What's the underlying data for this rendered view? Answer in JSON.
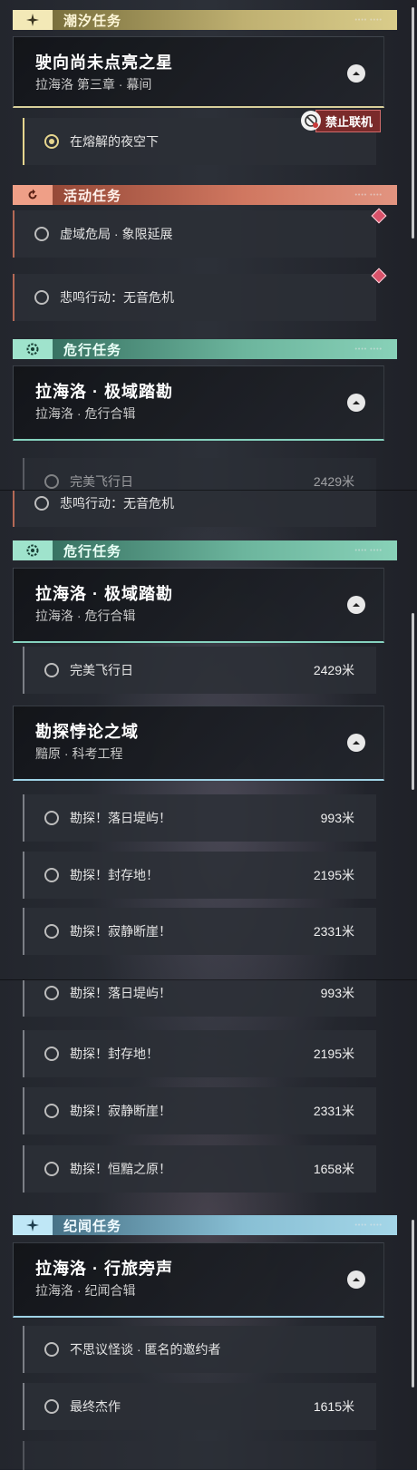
{
  "segment_a": {
    "cat_tide": "潮汐任务",
    "tide_mission": {
      "title": "驶向尚未点亮之星",
      "subtitle": "拉海洛 第三章 · 幕间"
    },
    "tide_task": "在熔解的夜空下",
    "no_coop_label": "禁止联机",
    "cat_event": "活动任务",
    "event_tasks": [
      "虚域危局 · 象限延展",
      "悲鸣行动：无音危机"
    ],
    "cat_danger": "危行任务",
    "danger_mission": {
      "title": "拉海洛 · 极域踏勘",
      "subtitle": "拉海洛 · 危行合辑"
    },
    "partial_task": {
      "label": "完美飞行日",
      "dist": "2429米"
    }
  },
  "segment_b": {
    "partial_task": "悲鸣行动：无音危机",
    "cat_danger": "危行任务",
    "danger_mission": {
      "title": "拉海洛 · 极域踏勘",
      "subtitle": "拉海洛 · 危行合辑"
    },
    "flight_task": {
      "label": "完美飞行日",
      "dist": "2429米"
    },
    "explore_mission": {
      "title": "勘探悖论之域",
      "subtitle": "黯原 · 科考工程"
    },
    "explore_tasks": [
      {
        "label": "勘探！落日堤屿！",
        "dist": "993米"
      },
      {
        "label": "勘探！封存地！",
        "dist": "2195米"
      },
      {
        "label": "勘探！寂静断崖！",
        "dist": "2331米"
      }
    ]
  },
  "segment_c": {
    "explore_tasks": [
      {
        "label": "勘探！落日堤屿！",
        "dist": "993米"
      },
      {
        "label": "勘探！封存地！",
        "dist": "2195米"
      },
      {
        "label": "勘探！寂静断崖！",
        "dist": "2331米"
      },
      {
        "label": "勘探！恒黯之原！",
        "dist": "1658米"
      }
    ],
    "cat_story": "纪闻任务",
    "story_mission": {
      "title": "拉海洛 · 行旅旁声",
      "subtitle": "拉海洛 · 纪闻合辑"
    },
    "story_tasks": [
      {
        "label": "不思议怪谈 · 匿名的邀约者",
        "dist": ""
      },
      {
        "label": "最终杰作",
        "dist": "1615米"
      }
    ]
  },
  "icons": {
    "tide": "sparkle-icon",
    "event": "refresh-icon",
    "danger": "warning-gear-icon",
    "story": "sparkle-icon",
    "collapse": "chevron-up-icon",
    "no_coop": "no-coop-icon"
  },
  "colors": {
    "tide": "#e6d58e",
    "event": "#d07760",
    "danger": "#6cb59d",
    "story": "#88bfd4",
    "alert": "#d8526a"
  }
}
